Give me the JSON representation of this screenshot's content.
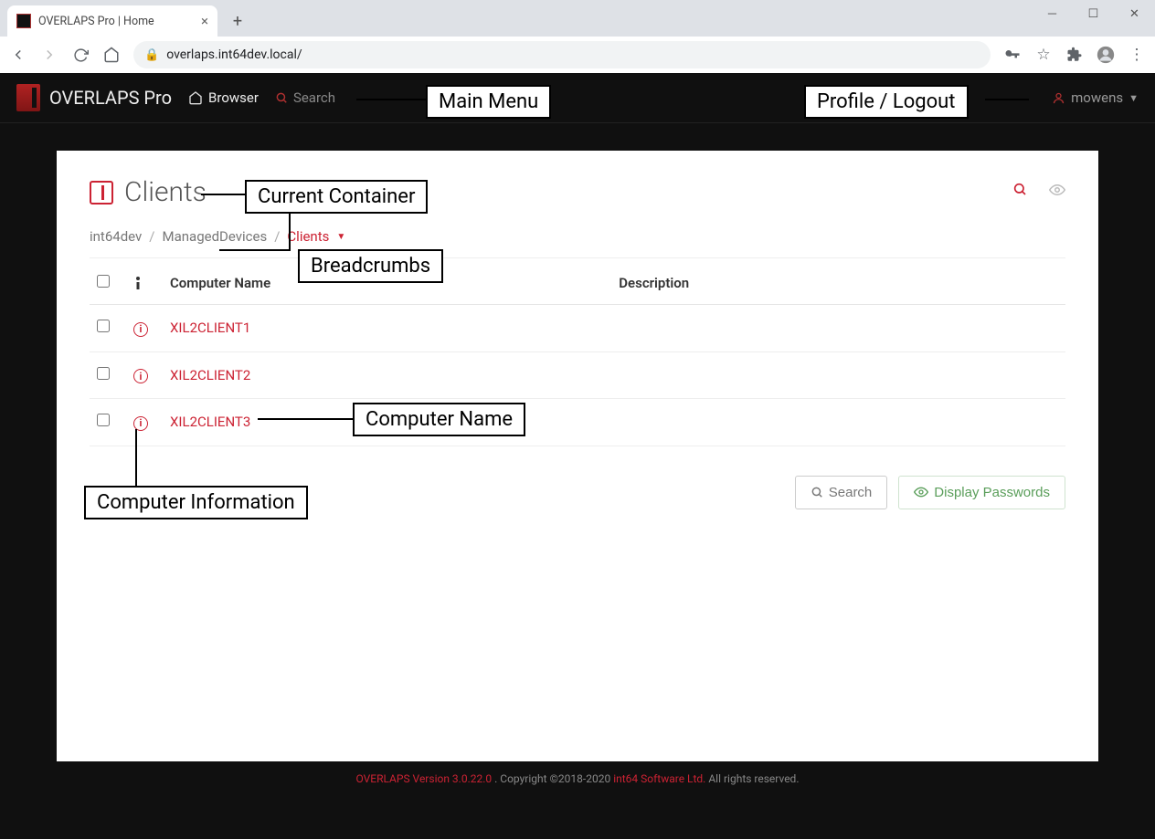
{
  "browser": {
    "tab_title": "OVERLAPS Pro | Home",
    "url": "overlaps.int64dev.local/"
  },
  "header": {
    "brand": "OVERLAPS Pro",
    "nav_browser": "Browser",
    "nav_search": "Search",
    "user": "mowens"
  },
  "callouts": {
    "main_menu": "Main Menu",
    "profile": "Profile / Logout",
    "current_container": "Current Container",
    "breadcrumbs": "Breadcrumbs",
    "computer_name": "Computer Name",
    "computer_info": "Computer Information"
  },
  "page": {
    "title": "Clients",
    "crumbs": [
      "int64dev",
      "ManagedDevices",
      "Clients"
    ],
    "columns": {
      "name": "Computer Name",
      "desc": "Description"
    },
    "rows": [
      {
        "name": "XIL2CLIENT1",
        "desc": ""
      },
      {
        "name": "XIL2CLIENT2",
        "desc": ""
      },
      {
        "name": "XIL2CLIENT3",
        "desc": ""
      }
    ],
    "actions": {
      "search": "Search",
      "display_passwords": "Display Passwords"
    }
  },
  "footer": {
    "version": "OVERLAPS Version 3.0.22.0",
    "copyright": ". Copyright ©2018-2020 ",
    "company": "int64 Software Ltd.",
    "rights": " All rights reserved."
  }
}
